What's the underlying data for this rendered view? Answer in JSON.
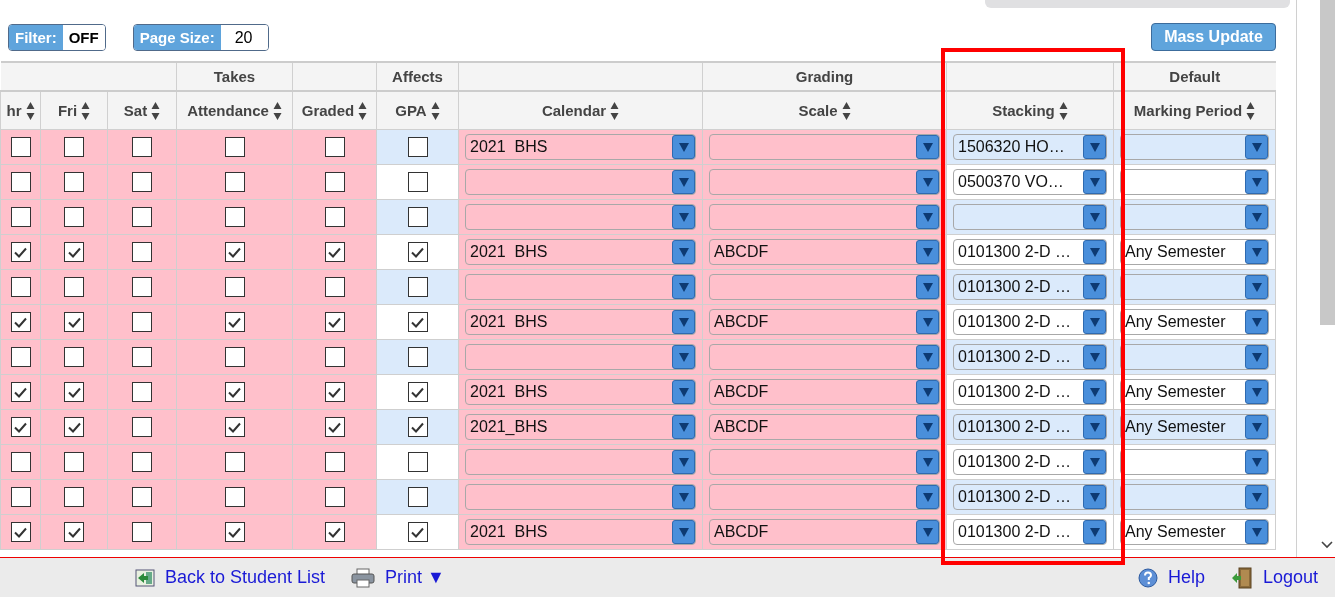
{
  "toolbar": {
    "filter": {
      "label": "Filter:",
      "value": "OFF"
    },
    "page_size": {
      "label": "Page Size:",
      "value": "20"
    },
    "mass_update": "Mass Update"
  },
  "table": {
    "columns": [
      {
        "label": "hr",
        "kind": "checkbox",
        "highlighted": true
      },
      {
        "label": "Fri",
        "kind": "checkbox",
        "highlighted": true
      },
      {
        "label": "Sat",
        "kind": "checkbox",
        "highlighted": true
      },
      {
        "label": "Attendance",
        "group": "Takes",
        "kind": "checkbox",
        "highlighted": true
      },
      {
        "label": "Graded",
        "kind": "checkbox",
        "highlighted": true
      },
      {
        "label": "GPA",
        "group": "Affects",
        "kind": "checkbox",
        "highlighted": false
      },
      {
        "label": "Calendar",
        "kind": "select",
        "highlighted": true
      },
      {
        "label": "Scale",
        "group": "Grading",
        "kind": "select",
        "highlighted": true
      },
      {
        "label": "Stacking",
        "kind": "select",
        "highlighted": false
      },
      {
        "label": "Marking Period",
        "group": "Default",
        "kind": "select",
        "highlighted": false
      }
    ],
    "rows": [
      {
        "cells": [
          {
            "checked": false
          },
          {
            "checked": false
          },
          {
            "checked": false
          },
          {
            "checked": false
          },
          {
            "checked": false
          },
          {
            "checked": false
          },
          {
            "value": "2021  BHS"
          },
          {},
          {
            "value": "1506320 HO…"
          },
          {}
        ]
      },
      {
        "cells": [
          {
            "checked": false
          },
          {
            "checked": false
          },
          {
            "checked": false
          },
          {
            "checked": false
          },
          {
            "checked": false
          },
          {
            "checked": false
          },
          {},
          {},
          {
            "value": "0500370 VO…"
          },
          {}
        ]
      },
      {
        "cells": [
          {
            "checked": false
          },
          {
            "checked": false
          },
          {
            "checked": false
          },
          {
            "checked": false
          },
          {
            "checked": false
          },
          {
            "checked": false
          },
          {},
          {},
          {},
          {}
        ]
      },
      {
        "cells": [
          {
            "checked": true
          },
          {
            "checked": true
          },
          {
            "checked": false
          },
          {
            "checked": true
          },
          {
            "checked": true
          },
          {
            "checked": true
          },
          {
            "value": "2021  BHS"
          },
          {
            "value": "ABCDF"
          },
          {
            "value": "0101300 2-D …"
          },
          {
            "value": "Any Semester"
          }
        ]
      },
      {
        "cells": [
          {
            "checked": false
          },
          {
            "checked": false
          },
          {
            "checked": false
          },
          {
            "checked": false
          },
          {
            "checked": false
          },
          {
            "checked": false
          },
          {},
          {},
          {
            "value": "0101300 2-D …"
          },
          {}
        ]
      },
      {
        "cells": [
          {
            "checked": true
          },
          {
            "checked": true
          },
          {
            "checked": false
          },
          {
            "checked": true
          },
          {
            "checked": true
          },
          {
            "checked": true
          },
          {
            "value": "2021  BHS"
          },
          {
            "value": "ABCDF"
          },
          {
            "value": "0101300 2-D …"
          },
          {
            "value": "Any Semester"
          }
        ]
      },
      {
        "cells": [
          {
            "checked": false
          },
          {
            "checked": false
          },
          {
            "checked": false
          },
          {
            "checked": false
          },
          {
            "checked": false
          },
          {
            "checked": false
          },
          {},
          {},
          {
            "value": "0101300 2-D …"
          },
          {}
        ]
      },
      {
        "cells": [
          {
            "checked": true
          },
          {
            "checked": true
          },
          {
            "checked": false
          },
          {
            "checked": true
          },
          {
            "checked": true
          },
          {
            "checked": true
          },
          {
            "value": "2021  BHS"
          },
          {
            "value": "ABCDF"
          },
          {
            "value": "0101300 2-D …"
          },
          {
            "value": "Any Semester"
          }
        ]
      },
      {
        "cells": [
          {
            "checked": true
          },
          {
            "checked": true
          },
          {
            "checked": false
          },
          {
            "checked": true
          },
          {
            "checked": true
          },
          {
            "checked": true
          },
          {
            "value": "2021_BHS"
          },
          {
            "value": "ABCDF"
          },
          {
            "value": "0101300 2-D …"
          },
          {
            "value": "Any Semester"
          }
        ]
      },
      {
        "cells": [
          {
            "checked": false
          },
          {
            "checked": false
          },
          {
            "checked": false
          },
          {
            "checked": false
          },
          {
            "checked": false
          },
          {
            "checked": false
          },
          {},
          {},
          {
            "value": "0101300 2-D …"
          },
          {}
        ]
      },
      {
        "cells": [
          {
            "checked": false
          },
          {
            "checked": false
          },
          {
            "checked": false
          },
          {
            "checked": false
          },
          {
            "checked": false
          },
          {
            "checked": false
          },
          {},
          {},
          {
            "value": "0101300 2-D …"
          },
          {}
        ]
      },
      {
        "cells": [
          {
            "checked": true
          },
          {
            "checked": true
          },
          {
            "checked": false
          },
          {
            "checked": true
          },
          {
            "checked": true
          },
          {
            "checked": true
          },
          {
            "value": "2021  BHS"
          },
          {
            "value": "ABCDF"
          },
          {
            "value": "0101300 2-D …"
          },
          {
            "value": "Any Semester"
          }
        ]
      }
    ]
  },
  "footer": {
    "links": [
      {
        "label": "Back to Student List",
        "kind": "back"
      },
      {
        "label": "Print ▼",
        "kind": "print"
      }
    ],
    "right_links": [
      {
        "label": "Help",
        "kind": "help"
      },
      {
        "label": "Logout",
        "kind": "logout"
      }
    ]
  }
}
